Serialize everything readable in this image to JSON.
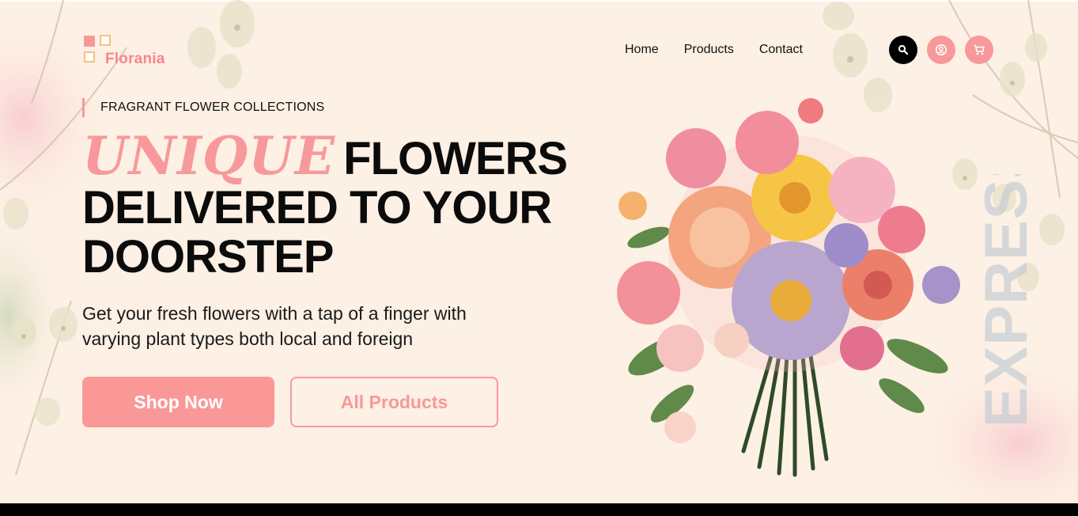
{
  "brand": {
    "name": "Florania"
  },
  "nav": {
    "home": "Home",
    "products": "Products",
    "contact": "Contact"
  },
  "icons": {
    "search": "search-icon",
    "user": "user-icon",
    "cart": "cart-icon"
  },
  "hero": {
    "tagline": "FRAGRANT FLOWER COLLECTIONS",
    "headline_accent": "UNIQUE",
    "headline_line1": "FLOWERS",
    "headline_line2": "DELIVERED TO YOUR",
    "headline_line3": "DOORSTEP",
    "subtext_line1": "Get your fresh flowers with a tap of a finger with",
    "subtext_line2": "varying plant types both local and foreign",
    "primary_button": "Shop Now",
    "secondary_button": "All Products",
    "side_text": "EXPRESS"
  },
  "colors": {
    "accent": "#f7999b",
    "background": "#fdf0e4",
    "text": "#0b0b0b",
    "logo_border": "#f5c37d"
  }
}
